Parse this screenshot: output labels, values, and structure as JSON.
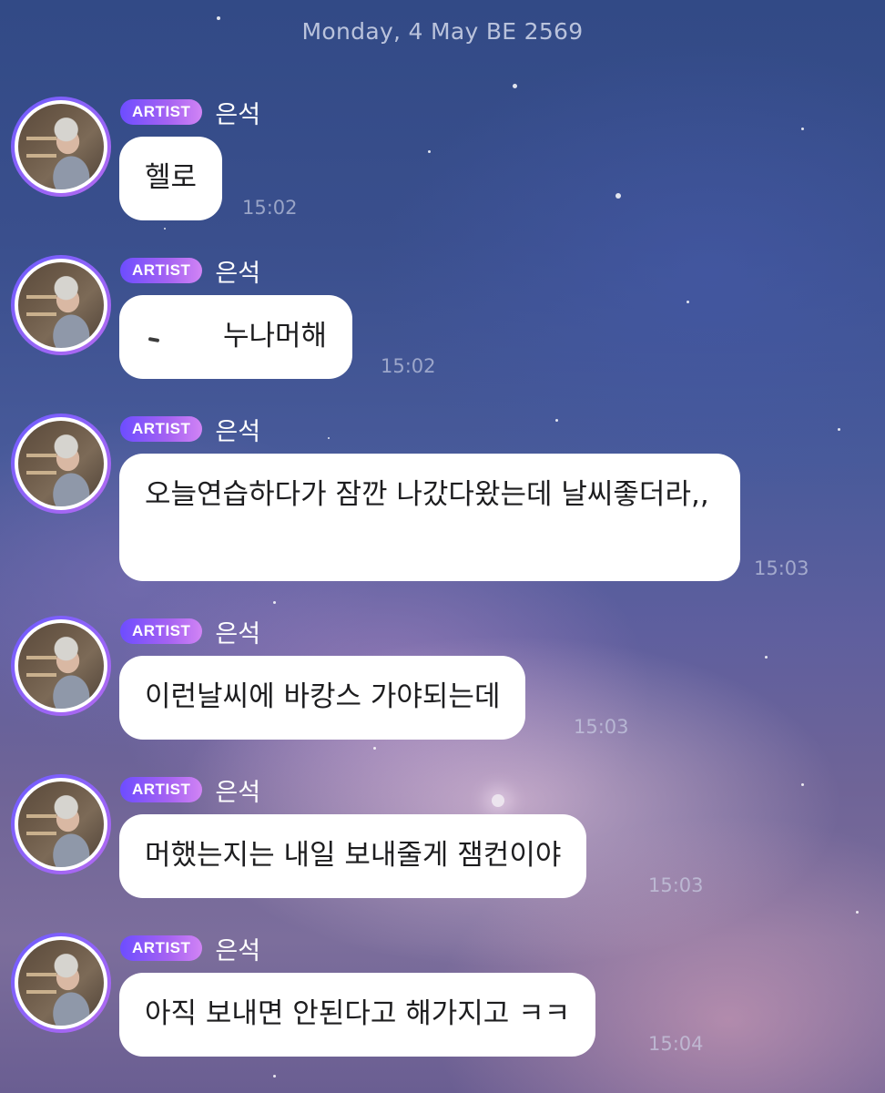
{
  "date_header": "Monday, 4 May BE 2569",
  "badge_label": "ARTIST",
  "messages": [
    {
      "sender": "은석",
      "text": "헬로",
      "time": "15:02"
    },
    {
      "sender": "은석",
      "text": "누나머해",
      "time": "15:02"
    },
    {
      "sender": "은석",
      "text": "오늘연습하다가 잠깐 나갔다왔는데 날씨좋더라,,",
      "time": "15:03"
    },
    {
      "sender": "은석",
      "text": "이런날씨에 바캉스 가야되는데",
      "time": "15:03"
    },
    {
      "sender": "은석",
      "text": "머했는지는 내일 보내줄게 잼컨이야",
      "time": "15:03"
    },
    {
      "sender": "은석",
      "text": "아직 보내면 안된다고 해가지고 ㅋㅋ",
      "time": "15:04"
    }
  ],
  "colors": {
    "badge_start": "#6d4dff",
    "badge_end": "#d184f5",
    "bubble": "#ffffff",
    "avatar_ring": "#8a5cf6"
  },
  "icons": {
    "avatar": "artist-avatar"
  }
}
